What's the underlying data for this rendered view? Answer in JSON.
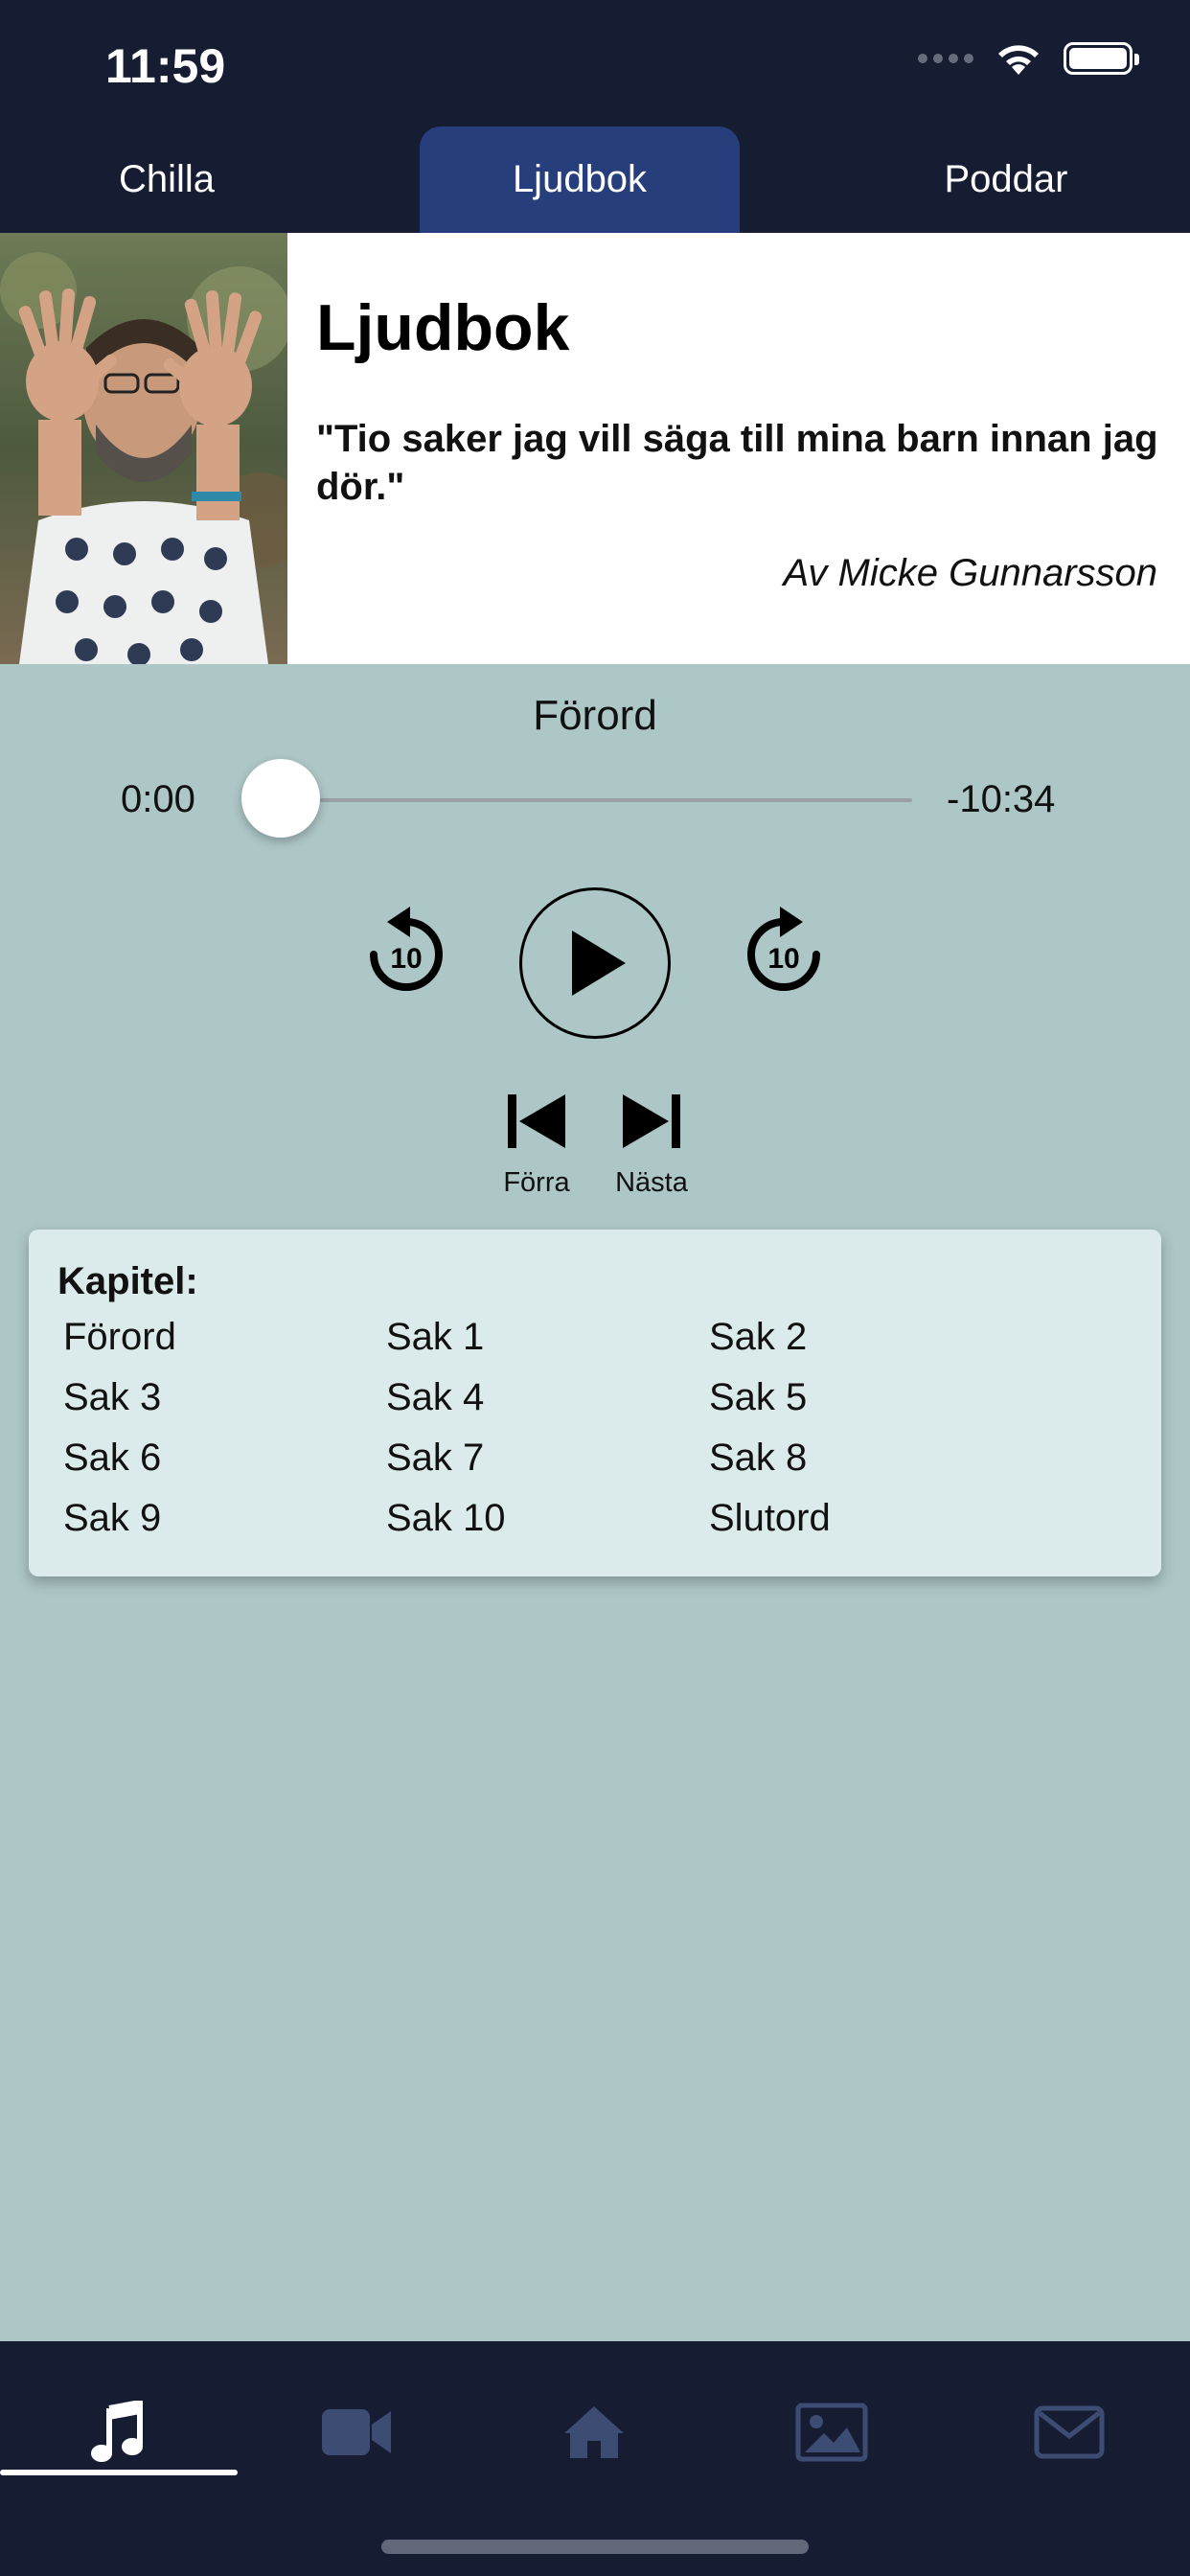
{
  "status_bar": {
    "time": "11:59"
  },
  "top_tabs": [
    {
      "label": "Chilla"
    },
    {
      "label": "Ljudbok",
      "active": true
    },
    {
      "label": "Poddar"
    }
  ],
  "hero": {
    "title": "Ljudbok",
    "quote": "\"Tio saker jag vill säga till mina barn innan jag dör.\"",
    "author": "Av Micke Gunnarsson"
  },
  "player": {
    "track_title": "Förord",
    "elapsed": "0:00",
    "remaining": "-10:34",
    "progress": 0,
    "skip_back_seconds": "10",
    "skip_forward_seconds": "10",
    "prev_label": "Förra",
    "next_label": "Nästa"
  },
  "chapters": {
    "title": "Kapitel:",
    "items": [
      "Förord",
      "Sak 1",
      "Sak 2",
      "Sak 3",
      "Sak 4",
      "Sak 5",
      "Sak 6",
      "Sak 7",
      "Sak 8",
      "Sak 9",
      "Sak 10",
      "Slutord"
    ]
  },
  "bottom_tabs": [
    {
      "icon": "music-note-icon",
      "active": true
    },
    {
      "icon": "video-camera-icon"
    },
    {
      "icon": "home-icon"
    },
    {
      "icon": "image-icon"
    },
    {
      "icon": "mail-icon"
    }
  ],
  "colors": {
    "nav_background": "#161d33",
    "active_tab": "#263e7b",
    "page_background": "#adc6c6",
    "card_background": "#dbeaea",
    "inactive_icon": "#3d4c73"
  }
}
